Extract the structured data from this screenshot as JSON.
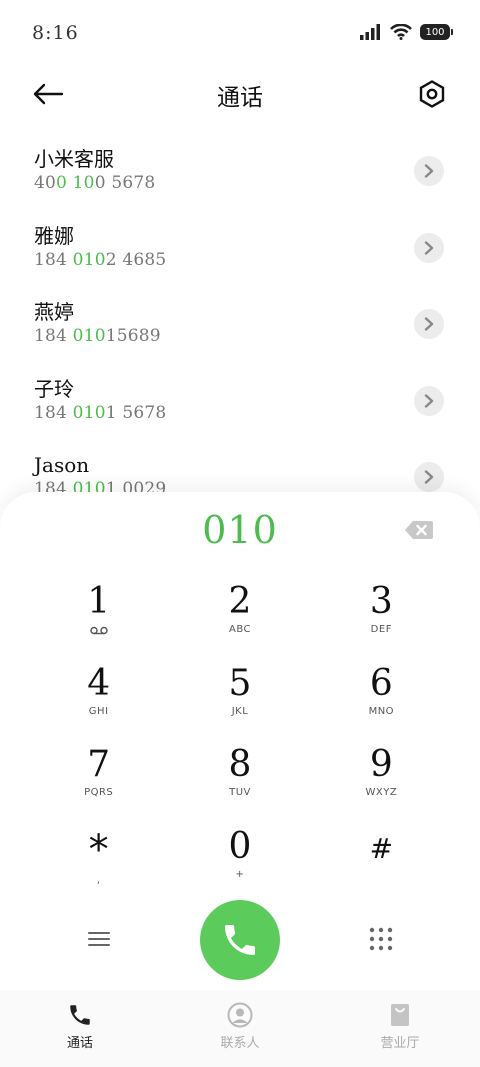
{
  "status_bar": {
    "time": "8:16",
    "battery": "100"
  },
  "header": {
    "title": "通话"
  },
  "contacts": [
    {
      "name": "小米客服",
      "number_parts": [
        "40",
        "0 10",
        "0 5678"
      ]
    },
    {
      "name": "雅娜",
      "number_parts": [
        "184 ",
        "010",
        "2 4685"
      ]
    },
    {
      "name": "燕婷",
      "number_parts": [
        "184 ",
        "010",
        "15689"
      ]
    },
    {
      "name": "子玲",
      "number_parts": [
        "184 ",
        "010",
        "1 5678"
      ]
    },
    {
      "name": "Jason",
      "number_parts": [
        "184 ",
        "010",
        "1 0029"
      ]
    }
  ],
  "dialer": {
    "input": "010",
    "keys": [
      {
        "digit": "1",
        "letters": ""
      },
      {
        "digit": "2",
        "letters": "ABC"
      },
      {
        "digit": "3",
        "letters": "DEF"
      },
      {
        "digit": "4",
        "letters": "GHI"
      },
      {
        "digit": "5",
        "letters": "JKL"
      },
      {
        "digit": "6",
        "letters": "MNO"
      },
      {
        "digit": "7",
        "letters": "PQRS"
      },
      {
        "digit": "8",
        "letters": "TUV"
      },
      {
        "digit": "9",
        "letters": "WXYZ"
      },
      {
        "digit": "*",
        "letters": ","
      },
      {
        "digit": "0",
        "letters": "+"
      },
      {
        "digit": "#",
        "letters": ""
      }
    ]
  },
  "bottom_nav": [
    {
      "label": "通话",
      "active": true
    },
    {
      "label": "联系人",
      "active": false
    },
    {
      "label": "营业厅",
      "active": false
    }
  ],
  "colors": {
    "accent": "#4cbc4e",
    "call_button": "#5bcb5b",
    "secondary_text": "#777777"
  }
}
